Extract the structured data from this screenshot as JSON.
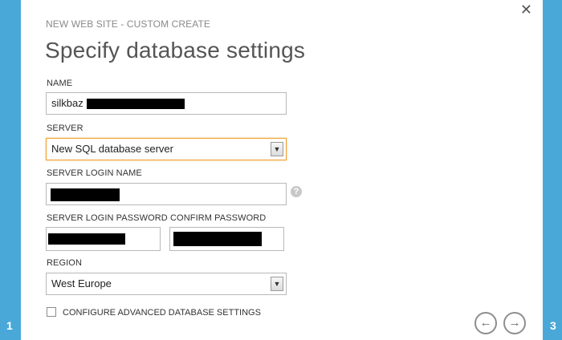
{
  "steps": {
    "left": "1",
    "right": "3"
  },
  "icons": {
    "close": "close-icon",
    "help": "help-icon",
    "back": "arrow-left-icon",
    "next": "arrow-right-icon"
  },
  "header": {
    "subtitle": "NEW WEB SITE - CUSTOM CREATE",
    "title": "Specify database settings"
  },
  "form": {
    "name_label": "NAME",
    "name_value": "silkbaz",
    "server_label": "SERVER",
    "server_value": "New SQL database server",
    "login_label": "SERVER LOGIN NAME",
    "password_label": "SERVER LOGIN PASSWORD",
    "confirm_label": "CONFIRM PASSWORD",
    "region_label": "REGION",
    "region_value": "West Europe",
    "advanced_label": "CONFIGURE ADVANCED DATABASE SETTINGS"
  },
  "colors": {
    "side_bar": "#4aa8d8",
    "focus_border": "#f0a030"
  }
}
